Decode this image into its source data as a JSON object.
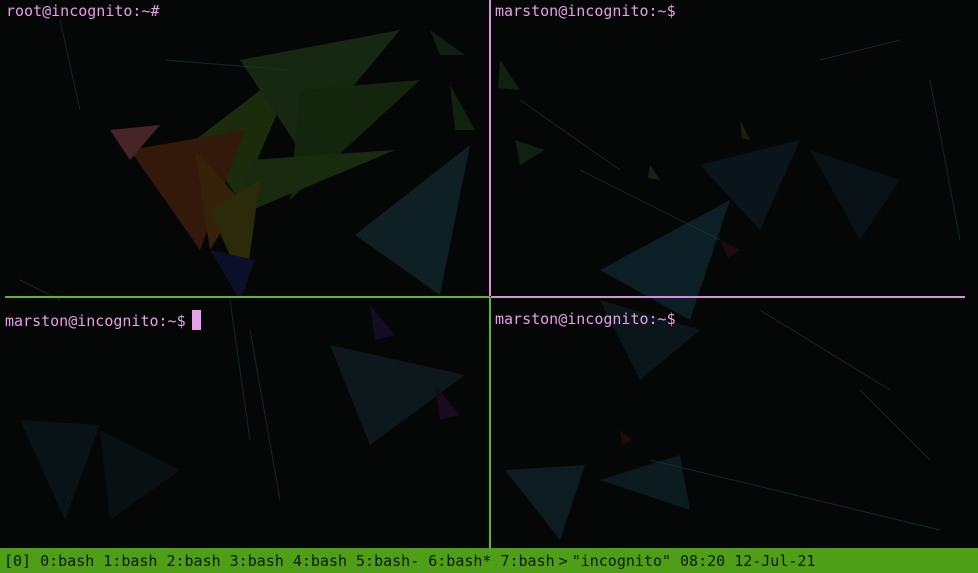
{
  "panes": [
    {
      "prompt": "root@incognito:~#",
      "active": false
    },
    {
      "prompt": "marston@incognito:~$",
      "active": false
    },
    {
      "prompt": "marston@incognito:~$",
      "active": true
    },
    {
      "prompt": "marston@incognito:~$",
      "active": false
    }
  ],
  "status": {
    "session": "[0]",
    "windows": [
      "0:bash",
      "1:bash",
      "2:bash",
      "3:bash",
      "4:bash",
      "5:bash-",
      "6:bash*",
      "7:bash"
    ],
    "separator": ">",
    "hostname": "\"incognito\"",
    "time": "08:20",
    "date": "12-Jul-21"
  },
  "colors": {
    "prompt": "#e79fe6",
    "active_border": "#5cb82a",
    "inactive_border": "#d98fd8",
    "status_bg": "#4f9e17",
    "background": "#050606"
  },
  "wallpaper": "dark low-poly geometric background with a polygonal parrot"
}
